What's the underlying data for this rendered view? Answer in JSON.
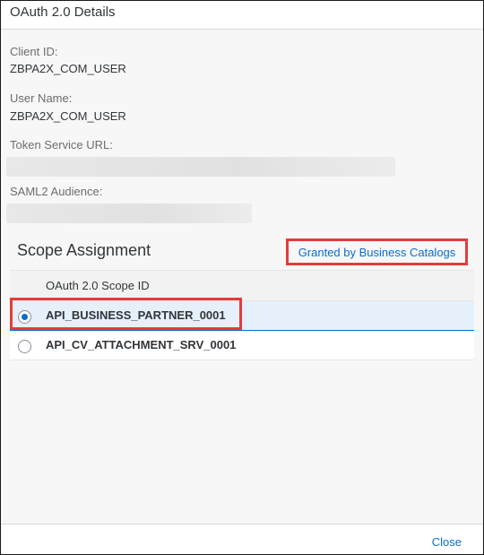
{
  "dialog": {
    "title": "OAuth 2.0 Details"
  },
  "fields": {
    "client_id_label": "Client ID:",
    "client_id_value": "ZBPA2X_COM_USER",
    "user_name_label": "User Name:",
    "user_name_value": "ZBPA2X_COM_USER",
    "token_url_label": "Token Service URL:",
    "saml_label": "SAML2 Audience:"
  },
  "scope": {
    "title": "Scope Assignment",
    "granted_link": "Granted by Business Catalogs",
    "column_header": "OAuth 2.0 Scope ID",
    "rows": [
      {
        "id": "API_BUSINESS_PARTNER_0001",
        "selected": true
      },
      {
        "id": "API_CV_ATTACHMENT_SRV_0001",
        "selected": false
      }
    ]
  },
  "footer": {
    "close_label": "Close"
  },
  "colors": {
    "accent": "#0a6ed1",
    "highlight": "#e63b3b",
    "selected_row": "#e5f0fa"
  }
}
